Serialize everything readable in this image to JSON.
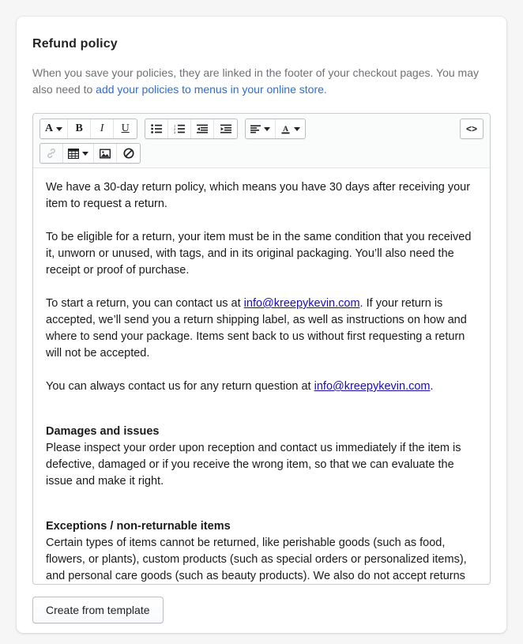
{
  "page": {
    "title": "Refund policy",
    "description_before": "When you save your policies, they are linked in the footer of your checkout pages. You may also need to ",
    "description_link": "add your policies to menus in your online store",
    "description_after": "."
  },
  "toolbar": {
    "row1": [
      {
        "name": "font-style-dropdown",
        "icon": "font-letter-A-icon",
        "glyph": "A",
        "caret": true
      },
      {
        "name": "bold-button",
        "icon": "bold-icon",
        "glyph": "B",
        "caret": false
      },
      {
        "name": "italic-button",
        "icon": "italic-icon",
        "glyph": "I",
        "caret": false
      },
      {
        "name": "underline-button",
        "icon": "underline-icon",
        "glyph": "U",
        "caret": false
      },
      {
        "name": "bulleted-list-button",
        "icon": "bulleted-list-icon",
        "glyph": "",
        "caret": false
      },
      {
        "name": "numbered-list-button",
        "icon": "numbered-list-icon",
        "glyph": "",
        "caret": false
      },
      {
        "name": "outdent-button",
        "icon": "outdent-icon",
        "glyph": "",
        "caret": false
      },
      {
        "name": "indent-button",
        "icon": "indent-icon",
        "glyph": "",
        "caret": false
      },
      {
        "name": "align-dropdown",
        "icon": "align-left-icon",
        "glyph": "",
        "caret": true
      },
      {
        "name": "text-color-dropdown",
        "icon": "text-color-A-icon",
        "glyph": "A",
        "caret": true
      }
    ],
    "row2": [
      {
        "name": "insert-link-button",
        "icon": "link-chain-icon",
        "glyph": "",
        "caret": false,
        "disabled": true
      },
      {
        "name": "insert-table-dropdown",
        "icon": "table-grid-icon",
        "glyph": "",
        "caret": true,
        "disabled": false
      },
      {
        "name": "insert-image-button",
        "icon": "image-picture-icon",
        "glyph": "",
        "caret": false,
        "disabled": false
      },
      {
        "name": "clear-formatting-button",
        "icon": "no-entry-slash-icon",
        "glyph": "",
        "caret": false,
        "disabled": false
      }
    ],
    "code_view_label": "<>"
  },
  "content": {
    "p1": "We have a 30-day return policy, which means you have 30 days after receiving your item to request a return.",
    "p2": "To be eligible for a return, your item must be in the same condition that you received it, unworn or unused, with tags, and in its original packaging. You’ll also need the receipt or proof of purchase.",
    "p3_before": "To start a return, you can contact us at ",
    "p3_link": "info@kreepykevin.com",
    "p3_after": ". If your return is accepted, we’ll send you a return shipping label, as well as instructions on how and where to send your package. Items sent back to us without first requesting a return will not be accepted.",
    "p4_before": "You can always contact us for any return question at ",
    "p4_link": "info@kreepykevin.com",
    "p4_after": ".",
    "h1": "Damages and issues",
    "p5": "Please inspect your order upon reception and contact us immediately if the item is defective, damaged or if you receive the wrong item, so that we can evaluate the issue and make it right.",
    "h2": "Exceptions / non-returnable items",
    "p6": "Certain types of items cannot be returned, like perishable goods (such as food, flowers, or plants), custom products (such as special orders or personalized items), and personal care goods (such as beauty products). We also do not accept returns"
  },
  "footer": {
    "create_from_template_label": "Create from template"
  },
  "colors": {
    "page_background": "#f6f6f7",
    "card_background": "#ffffff",
    "title_text": "#202223",
    "muted_text": "#6d7175",
    "description_link": "#2c6ecb",
    "content_link": "#1a0dab",
    "toolbar_background": "#fafbfb",
    "border": "#c9cccf"
  }
}
